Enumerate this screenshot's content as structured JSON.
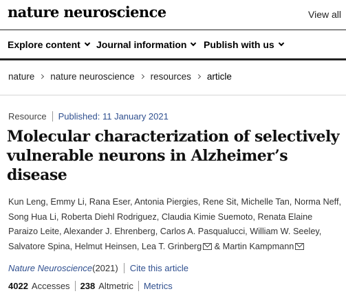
{
  "header": {
    "brand": "nature neuroscience",
    "view_all": "View all"
  },
  "nav": {
    "items": [
      {
        "label": "Explore content"
      },
      {
        "label": "Journal information"
      },
      {
        "label": "Publish with us"
      }
    ]
  },
  "breadcrumb": [
    "nature",
    "nature neuroscience",
    "resources",
    "article"
  ],
  "article": {
    "type": "Resource",
    "published": "Published: 11 January 2021",
    "title": "Molecular characterization of selectively vulnerable neurons in Alzheimer’s disease",
    "authors_line1": "Kun Leng, Emmy Li, Rana Eser, Antonia Piergies, Rene Sit, Michelle Tan, Norma Neff,",
    "authors_line2": "Song Hua Li, Roberta Diehl Rodriguez, Claudia Kimie Suemoto, Renata Elaine",
    "authors_line3": "Paraizo Leite, Alexander J. Ehrenberg, Carlos A. Pasqualucci, William W. Seeley,",
    "authors_line4_a": "Salvatore Spina, Helmut Heinsen, Lea T. Grinberg",
    "authors_line4_b": " & Martin Kampmann",
    "journal": "Nature Neuroscience",
    "year": " (2021)",
    "cite_label": "Cite this article",
    "accesses_count": "4022",
    "accesses_label": "Accesses",
    "altmetric_count": "238",
    "altmetric_label": "Altmetric",
    "metrics_label": "Metrics"
  },
  "icons": {
    "chevron": "chevron-down-icon",
    "crumb_separator": "chevron-right-icon",
    "email": "mail-icon"
  }
}
